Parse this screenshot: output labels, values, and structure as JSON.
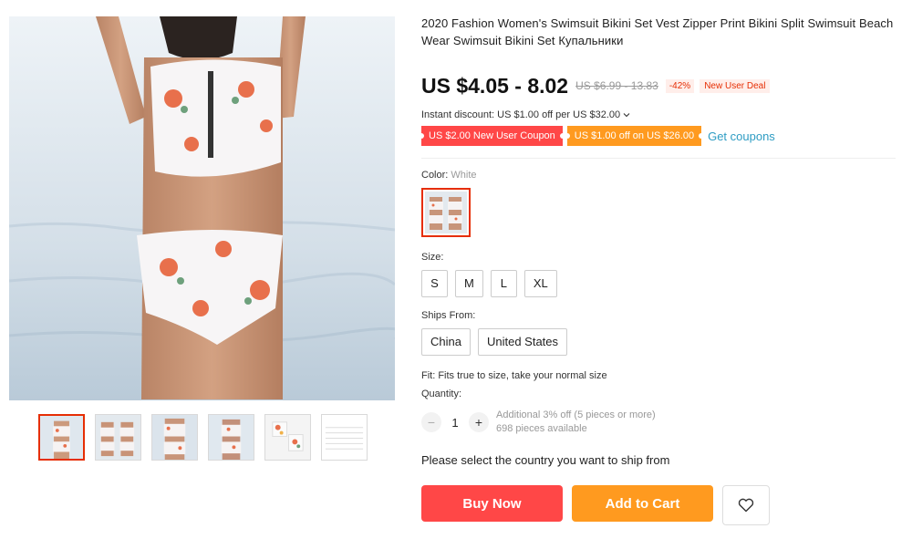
{
  "product": {
    "title": "2020 Fashion Women's Swimsuit Bikini Set Vest Zipper Print Bikini Split Swimsuit Beach Wear Swimsuit Bikini Set Купальники",
    "price": "US $4.05 - 8.02",
    "old_price": "US $6.99 - 13.83",
    "discount": "-42%",
    "deal_tag": "New User Deal"
  },
  "instant_discount": "Instant discount: US $1.00 off per US $32.00",
  "coupons": {
    "red": "US $2.00 New User Coupon",
    "orange": "US $1.00 off on US $26.00",
    "link": "Get coupons"
  },
  "color": {
    "label": "Color:",
    "selected": "White"
  },
  "size": {
    "label": "Size:",
    "options": [
      "S",
      "M",
      "L",
      "XL"
    ]
  },
  "ships_from": {
    "label": "Ships From:",
    "options": [
      "China",
      "United States"
    ]
  },
  "fit": "Fit: Fits true to size, take your normal size",
  "quantity": {
    "label": "Quantity:",
    "value": "1",
    "minus": "−",
    "plus": "+",
    "note1": "Additional 3% off (5 pieces or more)",
    "note2": "698 pieces available"
  },
  "ship_note": "Please select the country you want to ship from",
  "actions": {
    "buy": "Buy Now",
    "cart": "Add to Cart"
  },
  "colors": {
    "accent_red": "#ff4747",
    "accent_orange": "#ff9a1f",
    "link": "#2e9cc3",
    "selected_border": "#e62e04"
  },
  "icons": {
    "wishlist": "heart-icon",
    "dropdown": "chevron-down-icon"
  }
}
